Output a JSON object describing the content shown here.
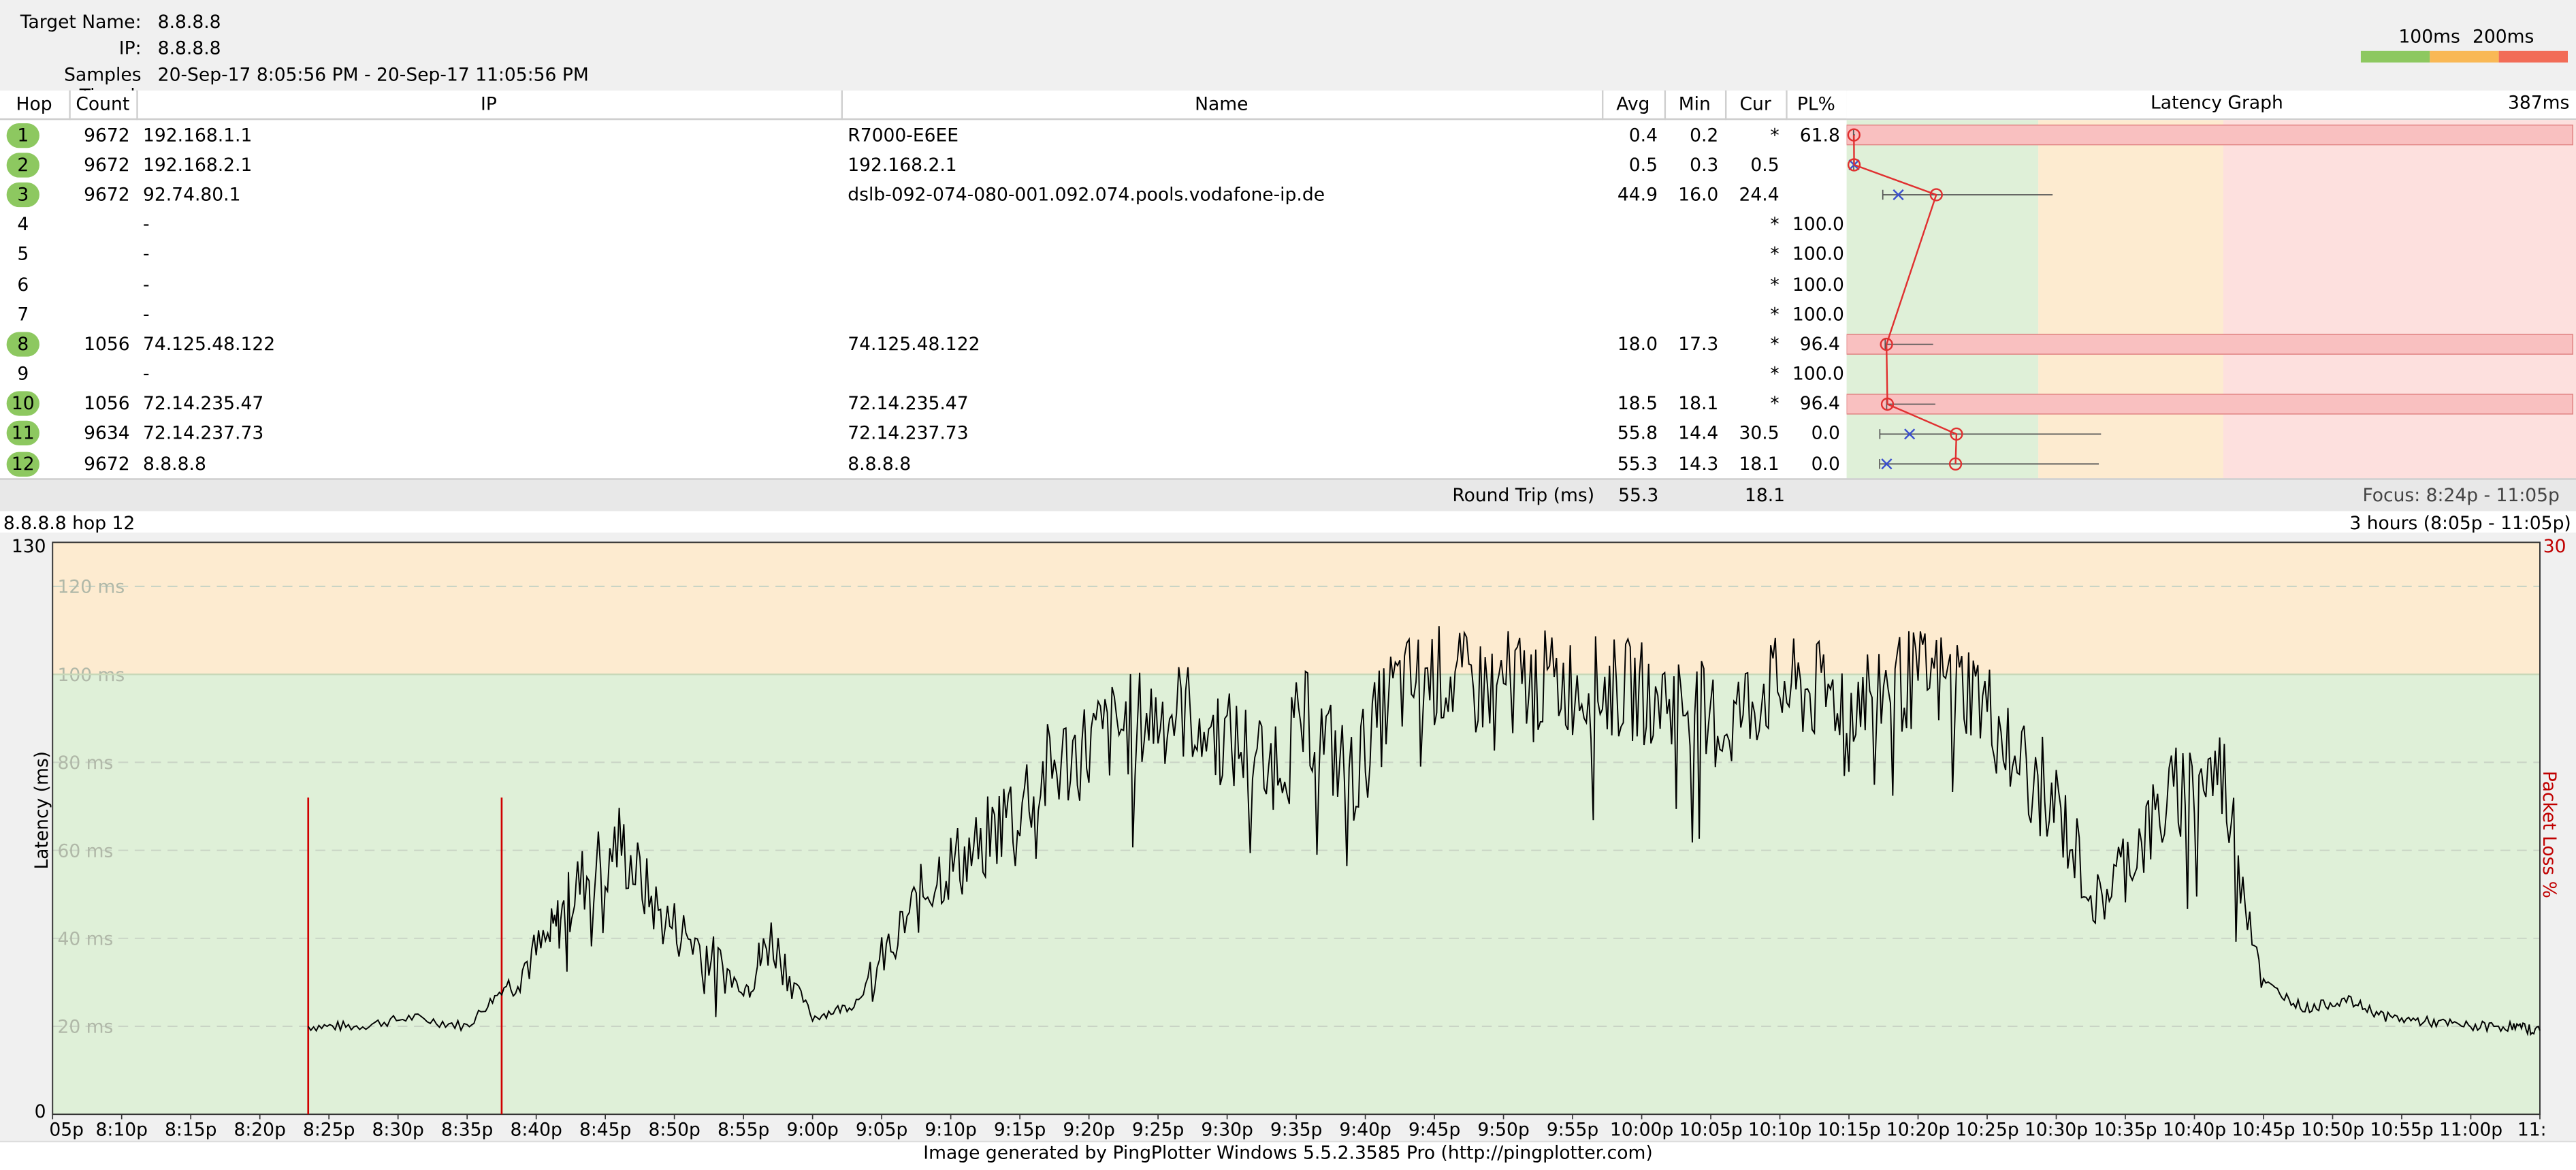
{
  "info": {
    "target_name_label": "Target Name:",
    "target_name": "8.8.8.8",
    "ip_label": "IP:",
    "ip": "8.8.8.8",
    "samples_label": "Samples Timed:",
    "samples": "20-Sep-17 8:05:56 PM - 20-Sep-17 11:05:56 PM"
  },
  "legend": {
    "label_100": "100ms",
    "label_200": "200ms",
    "colors": {
      "good": "#8dc860",
      "warn": "#f9b855",
      "bad": "#f26c57"
    }
  },
  "columns": {
    "hop": "Hop",
    "count": "Count",
    "ip": "IP",
    "name": "Name",
    "avg": "Avg",
    "min": "Min",
    "cur": "Cur",
    "pl": "PL%",
    "graph": "Latency Graph",
    "graph_max": "387ms"
  },
  "hops": [
    {
      "hop": "1",
      "count": "9672",
      "ip": "192.168.1.1",
      "name": "R7000-E6EE",
      "avg": "0.4",
      "min": "0.2",
      "cur": "*",
      "pl": "61.8",
      "ok": true
    },
    {
      "hop": "2",
      "count": "9672",
      "ip": "192.168.2.1",
      "name": "192.168.2.1",
      "avg": "0.5",
      "min": "0.3",
      "cur": "0.5",
      "pl": "",
      "ok": true
    },
    {
      "hop": "3",
      "count": "9672",
      "ip": "92.74.80.1",
      "name": "dslb-092-074-080-001.092.074.pools.vodafone-ip.de",
      "avg": "44.9",
      "min": "16.0",
      "cur": "24.4",
      "pl": "",
      "ok": true
    },
    {
      "hop": "4",
      "count": "",
      "ip": "-",
      "name": "",
      "avg": "",
      "min": "",
      "cur": "*",
      "pl": "100.0",
      "ok": false
    },
    {
      "hop": "5",
      "count": "",
      "ip": "-",
      "name": "",
      "avg": "",
      "min": "",
      "cur": "*",
      "pl": "100.0",
      "ok": false
    },
    {
      "hop": "6",
      "count": "",
      "ip": "-",
      "name": "",
      "avg": "",
      "min": "",
      "cur": "*",
      "pl": "100.0",
      "ok": false
    },
    {
      "hop": "7",
      "count": "",
      "ip": "-",
      "name": "",
      "avg": "",
      "min": "",
      "cur": "*",
      "pl": "100.0",
      "ok": false
    },
    {
      "hop": "8",
      "count": "1056",
      "ip": "74.125.48.122",
      "name": "74.125.48.122",
      "avg": "18.0",
      "min": "17.3",
      "cur": "*",
      "pl": "96.4",
      "ok": true
    },
    {
      "hop": "9",
      "count": "",
      "ip": "-",
      "name": "",
      "avg": "",
      "min": "",
      "cur": "*",
      "pl": "100.0",
      "ok": false
    },
    {
      "hop": "10",
      "count": "1056",
      "ip": "72.14.235.47",
      "name": "72.14.235.47",
      "avg": "18.5",
      "min": "18.1",
      "cur": "*",
      "pl": "96.4",
      "ok": true
    },
    {
      "hop": "11",
      "count": "9634",
      "ip": "72.14.237.73",
      "name": "72.14.237.73",
      "avg": "55.8",
      "min": "14.4",
      "cur": "30.5",
      "pl": "0.0",
      "ok": true
    },
    {
      "hop": "12",
      "count": "9672",
      "ip": "8.8.8.8",
      "name": "8.8.8.8",
      "avg": "55.3",
      "min": "14.3",
      "cur": "18.1",
      "pl": "0.0",
      "ok": true
    }
  ],
  "round_trip": {
    "label": "Round Trip (ms)",
    "avg": "55.3",
    "cur": "18.1",
    "focus": "Focus: 8:24p - 11:05p"
  },
  "time_graph": {
    "title_left": "8.8.8.8 hop 12",
    "title_right": "3 hours (8:05p - 11:05p)",
    "y_top": "130",
    "y_bottom": "0",
    "ylabel": "Latency (ms)",
    "right_axis_top": "30",
    "right_axis_label": "Packet Loss %",
    "grid_labels": [
      "120 ms",
      "100 ms",
      "80 ms",
      "60 ms",
      "40 ms",
      "20 ms"
    ],
    "time_labels": [
      "05p",
      "8:10p",
      "8:15p",
      "8:20p",
      "8:25p",
      "8:30p",
      "8:35p",
      "8:40p",
      "8:45p",
      "8:50p",
      "8:55p",
      "9:00p",
      "9:05p",
      "9:10p",
      "9:15p",
      "9:20p",
      "9:25p",
      "9:30p",
      "9:35p",
      "9:40p",
      "9:45p",
      "9:50p",
      "9:55p",
      "10:00p",
      "10:05p",
      "10:10p",
      "10:15p",
      "10:20p",
      "10:25p",
      "10:30p",
      "10:35p",
      "10:40p",
      "10:45p",
      "10:50p",
      "10:55p",
      "11:00p",
      "11:"
    ]
  },
  "chart_data": {
    "type": "line",
    "title": "8.8.8.8 hop 12",
    "xlabel": "",
    "ylabel": "Latency (ms)",
    "ylim": [
      0,
      130
    ],
    "y2label": "Packet Loss %",
    "y2lim": [
      0,
      30
    ],
    "x_unit": "minutes after 8:05p",
    "x": [
      18.5,
      22,
      26,
      30,
      33,
      36,
      38,
      41,
      44,
      47,
      50,
      52,
      55,
      58,
      61,
      64,
      67,
      70,
      73,
      76,
      79,
      82,
      85,
      88,
      91,
      94,
      97,
      100,
      103,
      106,
      109,
      112,
      115,
      118,
      121,
      124,
      127,
      130,
      133,
      136,
      139,
      142,
      145,
      148,
      151,
      154,
      157,
      160,
      163,
      166,
      169,
      172,
      175,
      178,
      180
    ],
    "values": [
      20,
      20,
      22,
      20,
      30,
      40,
      52,
      62,
      45,
      38,
      28,
      40,
      22,
      25,
      40,
      55,
      60,
      72,
      80,
      86,
      90,
      92,
      85,
      80,
      90,
      76,
      96,
      100,
      97,
      99,
      98,
      97,
      96,
      94,
      88,
      97,
      96,
      95,
      98,
      99,
      97,
      82,
      70,
      48,
      62,
      74,
      78,
      30,
      24,
      26,
      22,
      21,
      20,
      20,
      19
    ],
    "loss_spikes_x": [
      18.5,
      32.5
    ],
    "zones": [
      {
        "from": 0,
        "to": 100,
        "color": "#dff0d8"
      },
      {
        "from": 100,
        "to": 130,
        "color": "#fdebd0"
      }
    ]
  },
  "footer": "Image generated by PingPlotter Windows 5.5.2.3585 Pro (http://pingplotter.com)"
}
